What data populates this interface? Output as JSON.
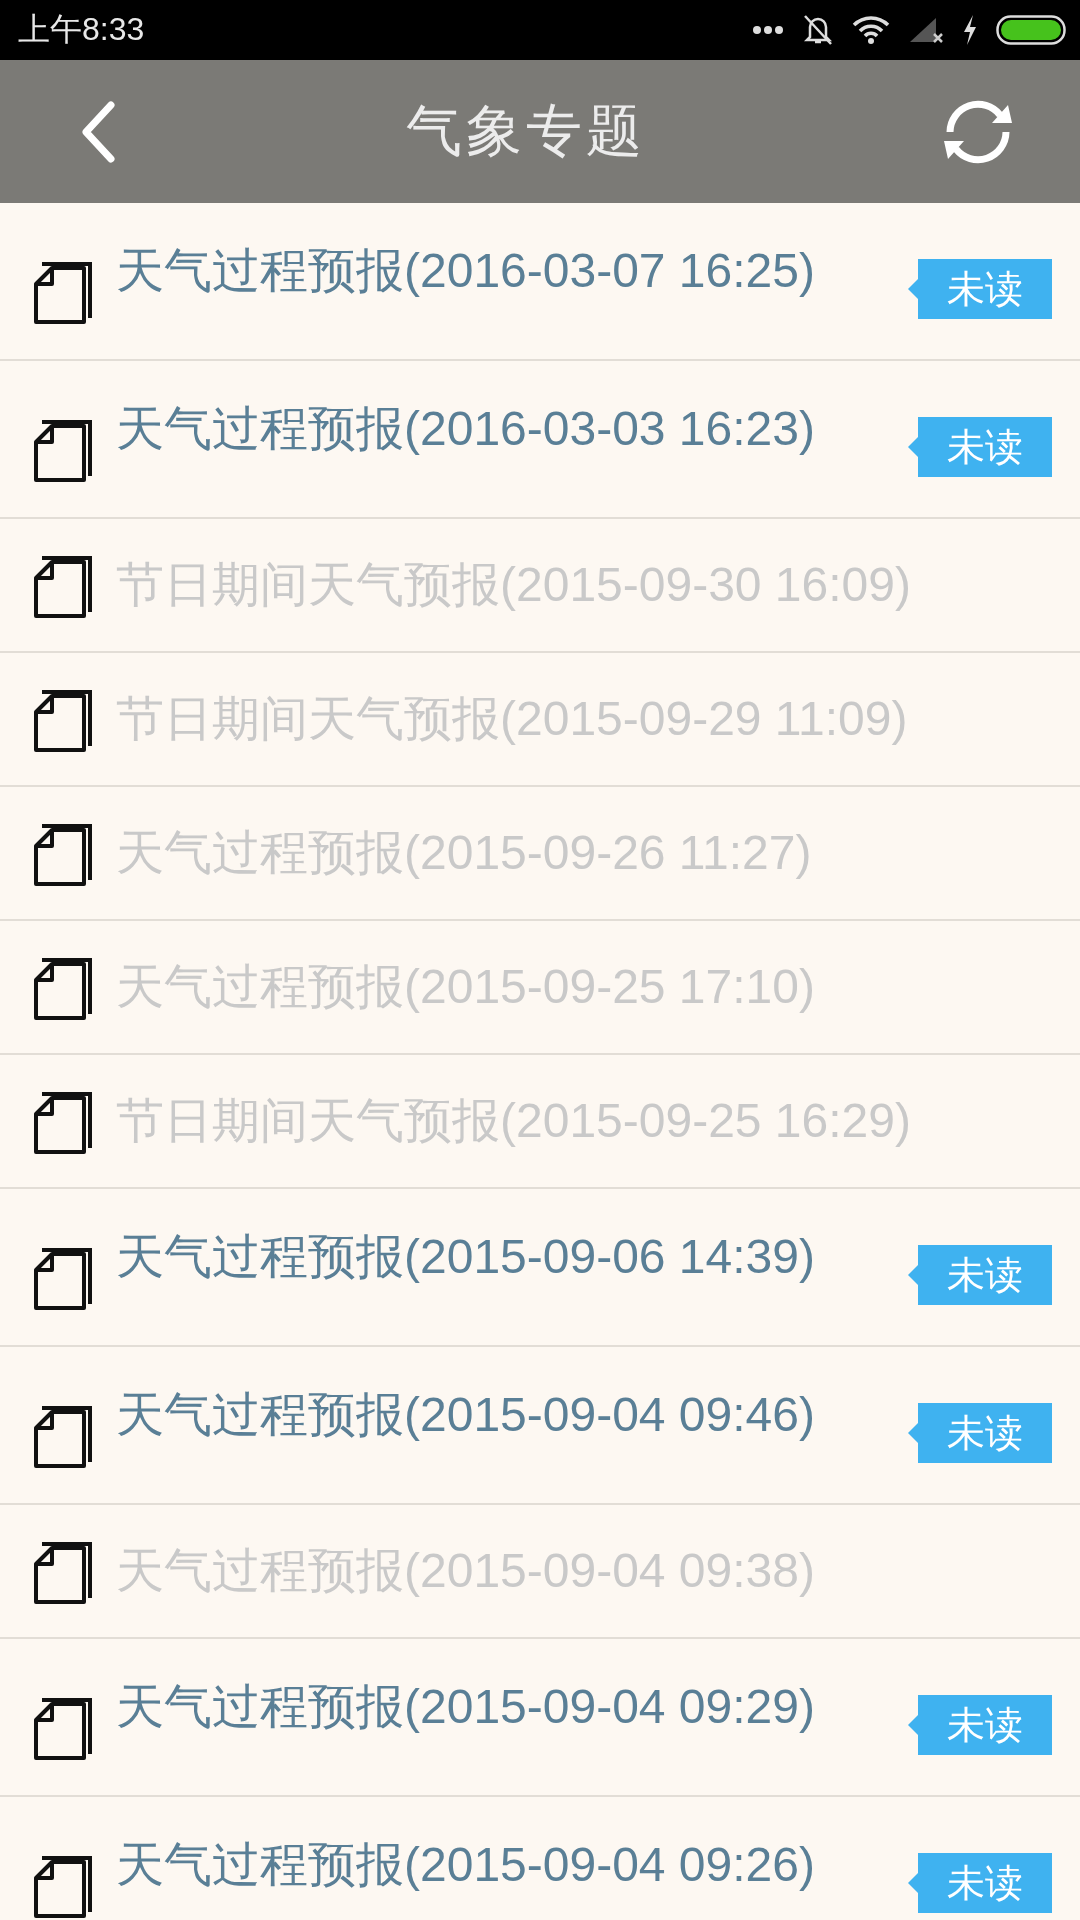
{
  "status_bar": {
    "time": "上午8:33"
  },
  "header": {
    "title": "气象专题"
  },
  "items": [
    {
      "title": "天气过程预报(2016-03-07 16:25)",
      "unread": true,
      "badge": "未读"
    },
    {
      "title": "天气过程预报(2016-03-03 16:23)",
      "unread": true,
      "badge": "未读"
    },
    {
      "title": "节日期间天气预报(2015-09-30 16:09)",
      "unread": false
    },
    {
      "title": "节日期间天气预报(2015-09-29 11:09)",
      "unread": false
    },
    {
      "title": "天气过程预报(2015-09-26 11:27)",
      "unread": false
    },
    {
      "title": "天气过程预报(2015-09-25 17:10)",
      "unread": false
    },
    {
      "title": "节日期间天气预报(2015-09-25 16:29)",
      "unread": false
    },
    {
      "title": "天气过程预报(2015-09-06 14:39)",
      "unread": true,
      "badge": "未读"
    },
    {
      "title": "天气过程预报(2015-09-04 09:46)",
      "unread": true,
      "badge": "未读"
    },
    {
      "title": "天气过程预报(2015-09-04 09:38)",
      "unread": false
    },
    {
      "title": "天气过程预报(2015-09-04 09:29)",
      "unread": true,
      "badge": "未读"
    },
    {
      "title": "天气过程预报(2015-09-04 09:26)",
      "unread": true,
      "badge": "未读"
    }
  ]
}
